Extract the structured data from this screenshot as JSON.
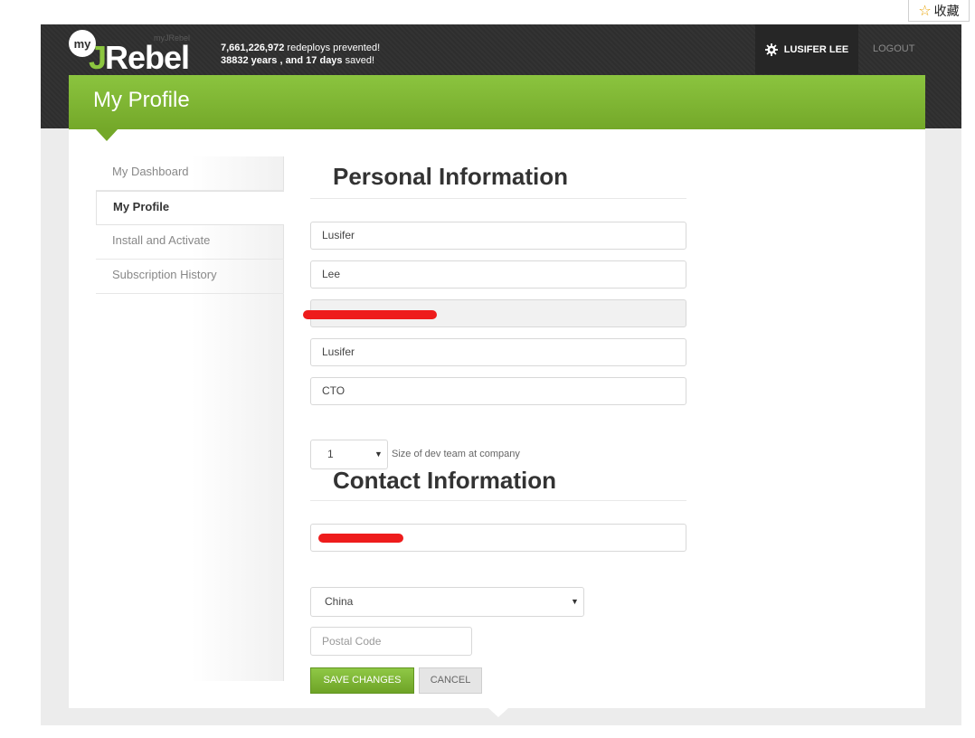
{
  "favorite": {
    "label": "收藏"
  },
  "header": {
    "logo": {
      "my": "my",
      "ghost": "myJRebel",
      "j": "J",
      "rebel": "Rebel"
    },
    "stats": {
      "redeploys_count": "7,661,226,972",
      "redeploys_text": " redeploys prevented!",
      "saved_years": "38832 years , and 17 days",
      "saved_text": " saved!"
    },
    "user_name": "LUSIFER LEE",
    "logout_label": "LOGOUT"
  },
  "page_title": "My Profile",
  "sidebar": {
    "items": [
      {
        "label": "My Dashboard",
        "active": false
      },
      {
        "label": "My Profile",
        "active": true
      },
      {
        "label": "Install and Activate",
        "active": false
      },
      {
        "label": "Subscription History",
        "active": false
      }
    ]
  },
  "personal": {
    "heading": "Personal Information",
    "first_name": "Lusifer",
    "last_name": "Lee",
    "email_redacted": "",
    "company": "Lusifer",
    "job_title": "CTO",
    "team_size": "1",
    "team_size_label": "Size of dev team at company"
  },
  "contact": {
    "heading": "Contact Information",
    "phone_redacted": "",
    "country": "China",
    "postal_placeholder": "Postal Code"
  },
  "buttons": {
    "save": "SAVE CHANGES",
    "cancel": "CANCEL"
  },
  "colors": {
    "brand_green": "#8bc43f",
    "topbar_dark": "#2e2e2e",
    "redaction": "#ee1c1c"
  }
}
